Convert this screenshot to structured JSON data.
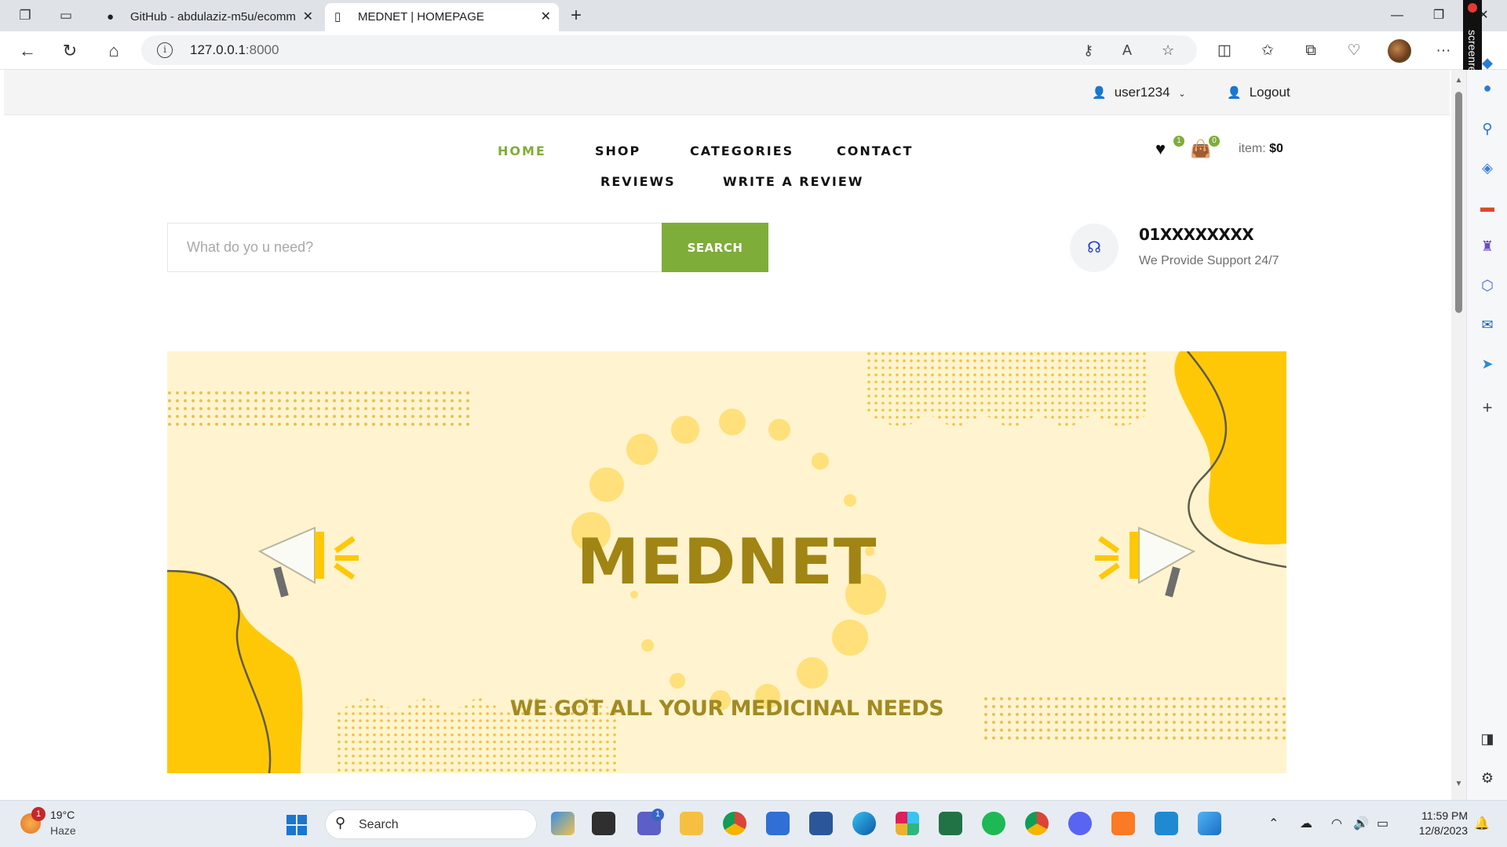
{
  "browser": {
    "tabs": [
      {
        "title": "GitHub - abdulaziz-m5u/ecomm"
      },
      {
        "title": "MEDNET | HOMEPAGE"
      }
    ],
    "url_host": "127.0.0.1",
    "url_port": ":8000"
  },
  "topbar": {
    "username": "user1234",
    "logout": "Logout"
  },
  "nav": {
    "items": [
      "HOME",
      "SHOP",
      "CATEGORIES",
      "CONTACT",
      "REVIEWS",
      "WRITE A REVIEW"
    ],
    "active": "HOME"
  },
  "header": {
    "wishlist_count": "1",
    "cart_count": "0",
    "item_label": "item:",
    "item_total": "$0"
  },
  "search": {
    "placeholder": "What do yo u need?",
    "button": "SEARCH"
  },
  "support": {
    "phone": "01XXXXXXXX",
    "text": "We Provide Support 24/7"
  },
  "banner": {
    "title": "MEDNET",
    "subtitle": "WE GOT ALL YOUR MEDICINAL NEEDS"
  },
  "colors": {
    "accent": "#7fad39",
    "banner_bg": "#fff4cf",
    "banner_yellow": "#ffc807",
    "banner_text": "#a08414"
  },
  "taskbar": {
    "temperature": "19°C",
    "weather": "Haze",
    "weather_badge": "1",
    "search_label": "Search",
    "teams_badge": "1",
    "time": "11:59 PM",
    "date": "12/8/2023"
  },
  "screenrec_label": "screenrec"
}
